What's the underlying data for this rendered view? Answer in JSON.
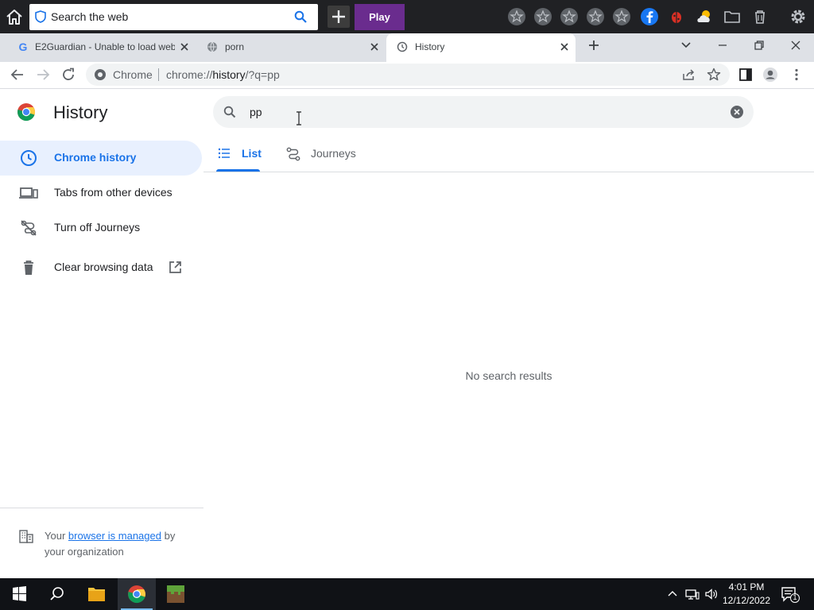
{
  "topbar": {
    "search_placeholder": "Search the web",
    "play_label": "Play",
    "icons": [
      "home-icon",
      "shield-icon",
      "search-icon",
      "plus-icon",
      "star-icon",
      "facebook-icon",
      "ladybug-icon",
      "weather-icon",
      "folder-icon",
      "trash-icon",
      "gear-icon"
    ]
  },
  "tabs": [
    {
      "title": "E2Guardian - Unable to load web",
      "favicon": "google-icon",
      "active": false
    },
    {
      "title": "porn",
      "favicon": "globe-icon",
      "active": false
    },
    {
      "title": "History",
      "favicon": "history-icon",
      "active": true
    }
  ],
  "address_bar": {
    "site_label": "Chrome",
    "url_prefix": "chrome://",
    "url_host": "history",
    "url_rest": "/?q=pp"
  },
  "page": {
    "title": "History",
    "search_value": "pp",
    "sidebar": [
      {
        "label": "Chrome history",
        "icon": "clock-icon",
        "active": true
      },
      {
        "label": "Tabs from other devices",
        "icon": "devices-icon",
        "active": false
      },
      {
        "label": "Turn off Journeys",
        "icon": "journeys-off-icon",
        "active": false
      },
      {
        "label": "Clear browsing data",
        "icon": "trash-icon",
        "active": false
      }
    ],
    "view_tabs": [
      {
        "label": "List",
        "active": true
      },
      {
        "label": "Journeys",
        "active": false
      }
    ],
    "empty_message": "No search results",
    "managed_prefix": "Your",
    "managed_link": "browser is managed",
    "managed_suffix": "by your organization"
  },
  "taskbar": {
    "time": "4:01 PM",
    "date": "12/12/2022",
    "notification_count": "1"
  },
  "colors": {
    "accent": "#1a73e8",
    "active_nav_bg": "#e8f0fe",
    "play_button": "#6a2c8e",
    "taskbar": "#101216"
  }
}
